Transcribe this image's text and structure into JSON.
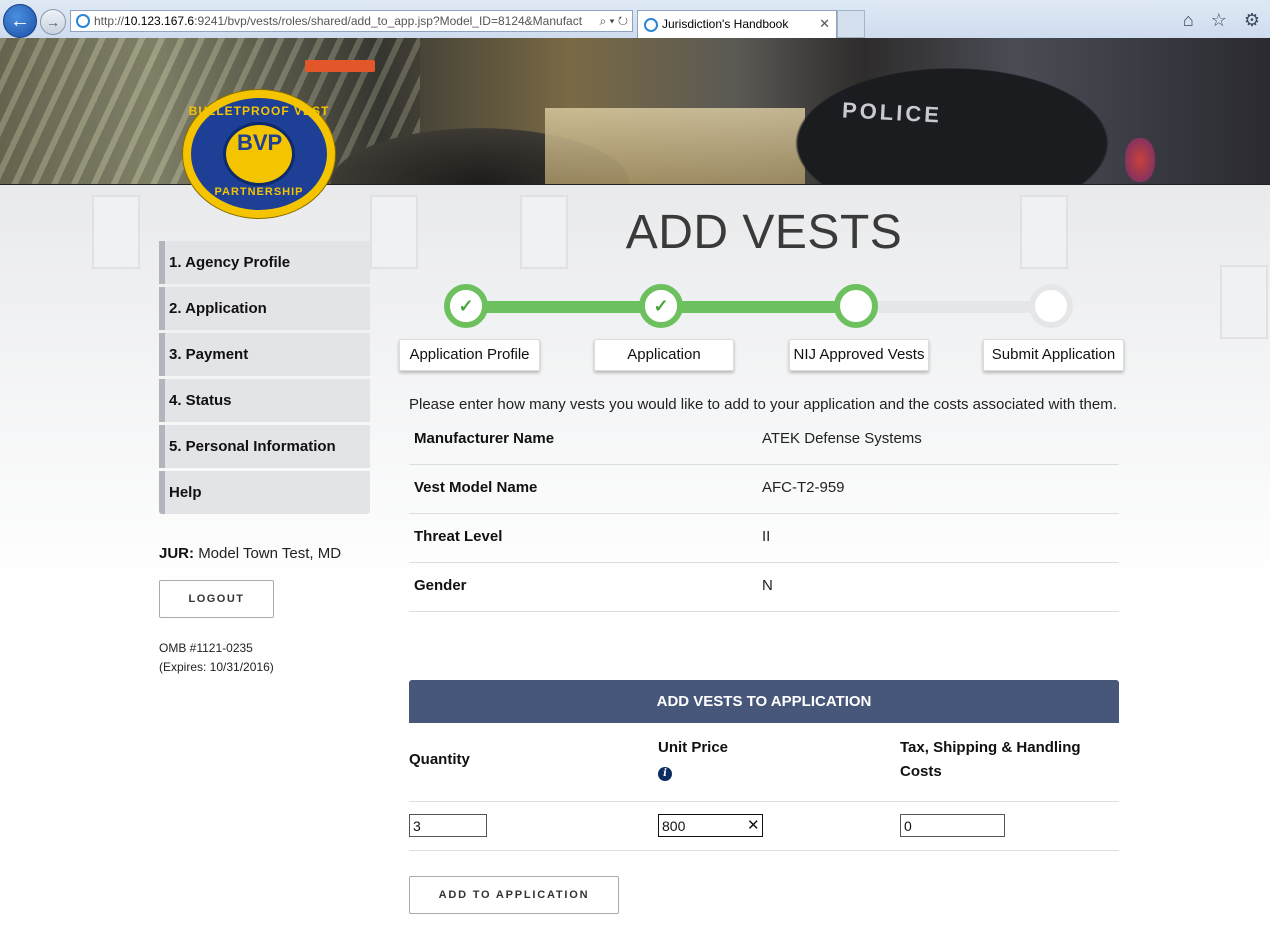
{
  "browser": {
    "url_prefix": "http://",
    "url_host": "10.123.167.6",
    "url_rest": ":9241/bvp/vests/roles/shared/add_to_app.jsp?Model_ID=8124&Manufact",
    "url_tools": "⌕ ▾ ↻",
    "tab_title": "Jurisdiction's Handbook",
    "tab_close": "✕",
    "right_icons": "⌂ ☆ ⚙"
  },
  "banner": {
    "police_text": "POLICE"
  },
  "logo": {
    "top_text": "BULLETPROOF VEST",
    "bottom_text": "PARTNERSHIP",
    "figures": "BVP"
  },
  "sidebar": {
    "items": [
      {
        "label": "1. Agency Profile"
      },
      {
        "label": "2. Application"
      },
      {
        "label": "3. Payment"
      },
      {
        "label": "4. Status"
      },
      {
        "label": "5. Personal Information"
      },
      {
        "label": "Help"
      }
    ]
  },
  "jurisdiction": {
    "label": "JUR:",
    "value": "Model Town Test, MD"
  },
  "logout_label": "LOGOUT",
  "omb": {
    "line1": "OMB #1121-0235",
    "line2": "(Expires: 10/31/2016)"
  },
  "page_title": "ADD VESTS",
  "steps": [
    {
      "label": "Application Profile",
      "state": "done"
    },
    {
      "label": "Application",
      "state": "done"
    },
    {
      "label": "NIJ Approved Vests",
      "state": "current"
    },
    {
      "label": "Submit Application",
      "state": "todo"
    }
  ],
  "check_glyph": "✓",
  "intro": "Please enter how many vests you would like to add to your application and the costs associated with them.",
  "details": [
    {
      "key": "Manufacturer Name",
      "value": "ATEK Defense Systems"
    },
    {
      "key": "Vest Model Name",
      "value": "AFC-T2-959"
    },
    {
      "key": "Threat Level",
      "value": "II"
    },
    {
      "key": "Gender",
      "value": "N"
    }
  ],
  "panel": {
    "title": "ADD VESTS TO APPLICATION",
    "col_quantity": "Quantity",
    "col_unit_price": "Unit Price",
    "col_tax_line1": "Tax, Shipping & Handling",
    "col_tax_line2": "Costs",
    "info_glyph": "i",
    "quantity_value": "3",
    "unit_price_value": "800",
    "tax_value": "0",
    "clear_glyph": "✕",
    "add_button": "ADD TO APPLICATION"
  },
  "colors": {
    "accent_green": "#6cc05e",
    "panel_header": "#46577a",
    "track_gray": "#e5e6e8"
  }
}
